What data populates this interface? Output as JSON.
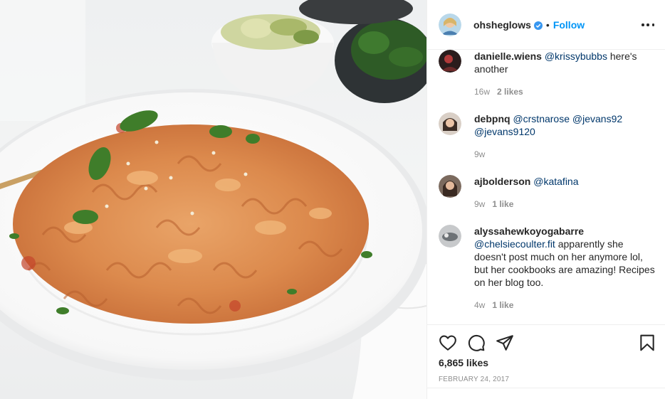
{
  "post": {
    "photo_alt": "",
    "author": {
      "username": "ohsheglows",
      "verified": true,
      "follow_label": "Follow",
      "separator": "•"
    }
  },
  "comments": [
    {
      "username": "danielle.wiens",
      "mentions": [
        "@krissybubbs"
      ],
      "text": "here's another",
      "age": "16w",
      "likes": "2 likes"
    },
    {
      "username": "debpnq",
      "mentions": [
        "@crstnarose",
        "@jevans92",
        "@jevans9120"
      ],
      "text": "",
      "age": "9w",
      "likes": ""
    },
    {
      "username": "ajbolderson",
      "mentions": [
        "@katafina"
      ],
      "text": "",
      "age": "9w",
      "likes": "1 like"
    },
    {
      "username": "alyssahewkoyogabarre",
      "mentions": [
        "@chelsiecoulter.fit"
      ],
      "text": "apparently she doesn't post much on her anymore lol, but her cookbooks are amazing! Recipes on her blog too.",
      "age": "4w",
      "likes": "1 like"
    }
  ],
  "actions": {
    "like_icon": "heart-icon",
    "comment_icon": "comment-icon",
    "share_icon": "share-icon",
    "save_icon": "bookmark-icon",
    "likes_count": "6,865 likes",
    "date": "FEBRUARY 24, 2017"
  },
  "colors": {
    "link_blue": "#0095f6",
    "mention_blue": "#00376b",
    "muted_gray": "#8e8e8e",
    "text": "#262626"
  }
}
